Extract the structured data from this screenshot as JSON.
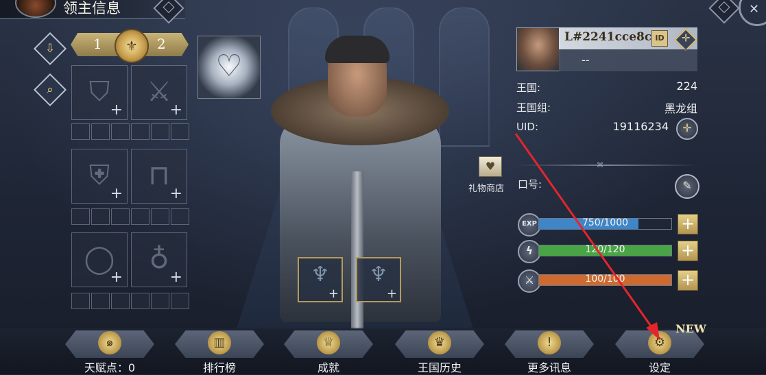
{
  "header": {
    "title": "领主信息"
  },
  "loadout": {
    "left": "1",
    "right": "2"
  },
  "profile": {
    "name": "L#2241cce8c94",
    "id_badge": "ID",
    "title": "--",
    "kingdom_label": "王国:",
    "kingdom_value": "224",
    "group_label": "王国组:",
    "group_value": "黑龙组",
    "uid_label": "UID:",
    "uid_value": "19116234",
    "slogan_label": "口号:"
  },
  "gift_shop": {
    "label": "礼物商店"
  },
  "stats": {
    "exp": {
      "icon_text": "EXP",
      "text": "750/1000",
      "fill": 0.75,
      "color": "#3f86c8"
    },
    "stamina": {
      "icon": "lightning-icon",
      "text": "120/120",
      "fill": 1.0,
      "color": "#48a444"
    },
    "battle": {
      "icon": "crossed-swords-icon",
      "text": "100/100",
      "fill": 1.0,
      "color": "#cf6a2f"
    }
  },
  "nav": {
    "talent": "天赋点：0",
    "ranking": "排行榜",
    "achievements": "成就",
    "history": "王国历史",
    "more_info": "更多讯息",
    "settings": "设定",
    "new_badge": "NEW"
  }
}
